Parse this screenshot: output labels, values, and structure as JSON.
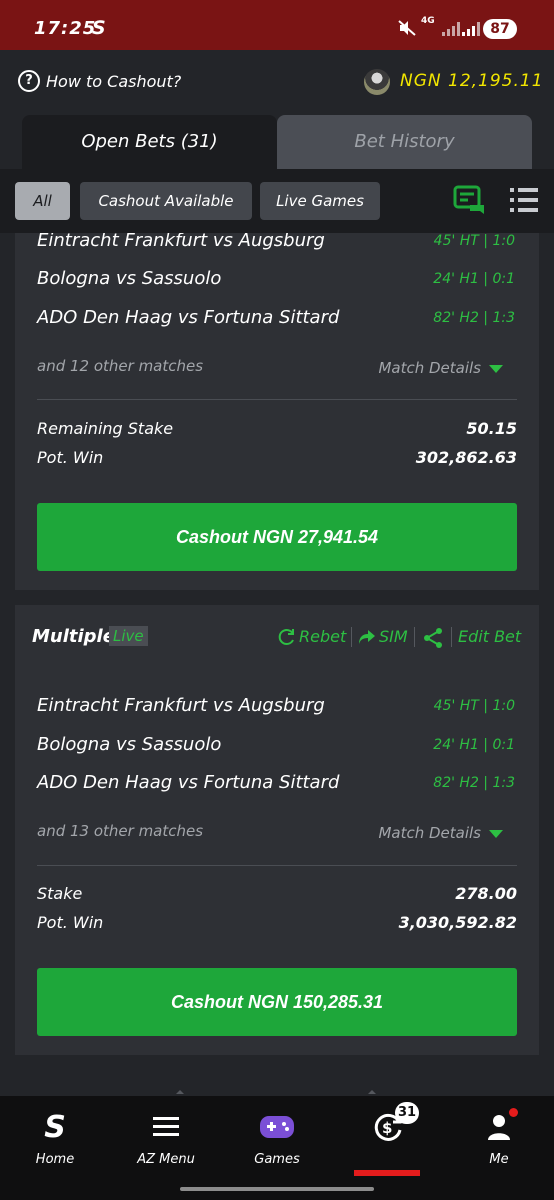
{
  "status_bar": {
    "time": "17:25",
    "app_icon": "S",
    "network": "4G",
    "battery": "87",
    "icons": [
      "mute-icon",
      "signal-icon",
      "signal-icon"
    ]
  },
  "header": {
    "how_to": "How to Cashout?",
    "balance": "NGN 12,195.11"
  },
  "tabs": [
    {
      "label": "Open Bets (31)",
      "active": true
    },
    {
      "label": "Bet History",
      "active": false
    }
  ],
  "filters": [
    {
      "label": "All",
      "active": true
    },
    {
      "label": "Cashout Available",
      "active": false
    },
    {
      "label": "Live Games",
      "active": false
    }
  ],
  "bets": [
    {
      "matches": [
        {
          "name": "Eintracht Frankfurt vs Augsburg",
          "status": "45' HT | 1:0"
        },
        {
          "name": "Bologna vs Sassuolo",
          "status": "24' H1 | 0:1"
        },
        {
          "name": "ADO Den Haag vs Fortuna Sittard",
          "status": "82' H2 | 1:3"
        }
      ],
      "others": "and 12 other matches",
      "details_label": "Match Details",
      "stake_label": "Remaining Stake",
      "stake": "50.15",
      "potwin_label": "Pot. Win",
      "potwin": "302,862.63",
      "cashout": "Cashout NGN 27,941.54"
    },
    {
      "title": "Multiple",
      "live": "Live",
      "actions": [
        "Rebet",
        "SIM",
        "Edit Bet"
      ],
      "matches": [
        {
          "name": "Eintracht Frankfurt vs Augsburg",
          "status": "45' HT | 1:0"
        },
        {
          "name": "Bologna vs Sassuolo",
          "status": "24' H1 | 0:1"
        },
        {
          "name": "ADO Den Haag vs Fortuna Sittard",
          "status": "82' H2 | 1:3"
        }
      ],
      "others": "and 13 other matches",
      "details_label": "Match Details",
      "stake_label": "Stake",
      "stake": "278.00",
      "potwin_label": "Pot. Win",
      "potwin": "3,030,592.82",
      "cashout": "Cashout NGN 150,285.31"
    }
  ],
  "bottom_nav": [
    {
      "label": "Home",
      "icon": "sportybet-logo-icon"
    },
    {
      "label": "AZ Menu",
      "icon": "menu-icon"
    },
    {
      "label": "Games",
      "icon": "gamepad-icon"
    },
    {
      "label": "",
      "icon": "cashout-icon",
      "badge": "31",
      "active": true
    },
    {
      "label": "Me",
      "icon": "user-icon"
    }
  ],
  "colors": {
    "accent": "#1ea73a",
    "status_bar": "#7a1414",
    "balance": "#f2e600",
    "live_green": "#2dbf43",
    "active_underline": "#e41c1c"
  }
}
